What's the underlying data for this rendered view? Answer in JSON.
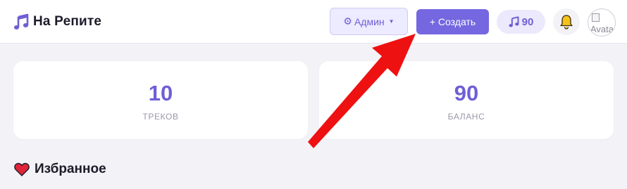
{
  "header": {
    "logo_icon": "music-note-icon",
    "title": "На Репите",
    "admin_label": "Админ",
    "admin_icon": "gear-icon",
    "create_label": "+ Создать",
    "balance_value": "90",
    "balance_icon": "music-note-icon",
    "notifications_icon": "bell-icon",
    "avatar_alt": "Avatar"
  },
  "stats": [
    {
      "value": "10",
      "label": "ТРЕКОВ"
    },
    {
      "value": "90",
      "label": "БАЛАНС"
    }
  ],
  "favorites": {
    "icon": "heart-icon",
    "title": "Избранное"
  },
  "annotation": {
    "type": "red-arrow",
    "target": "create-button",
    "color": "#ee1111"
  },
  "colors": {
    "accent": "#7467e0",
    "accent_text": "#6e5fd6",
    "background": "#f3f2f7",
    "bell": "#f7c21b",
    "heart": "#e0243a"
  }
}
